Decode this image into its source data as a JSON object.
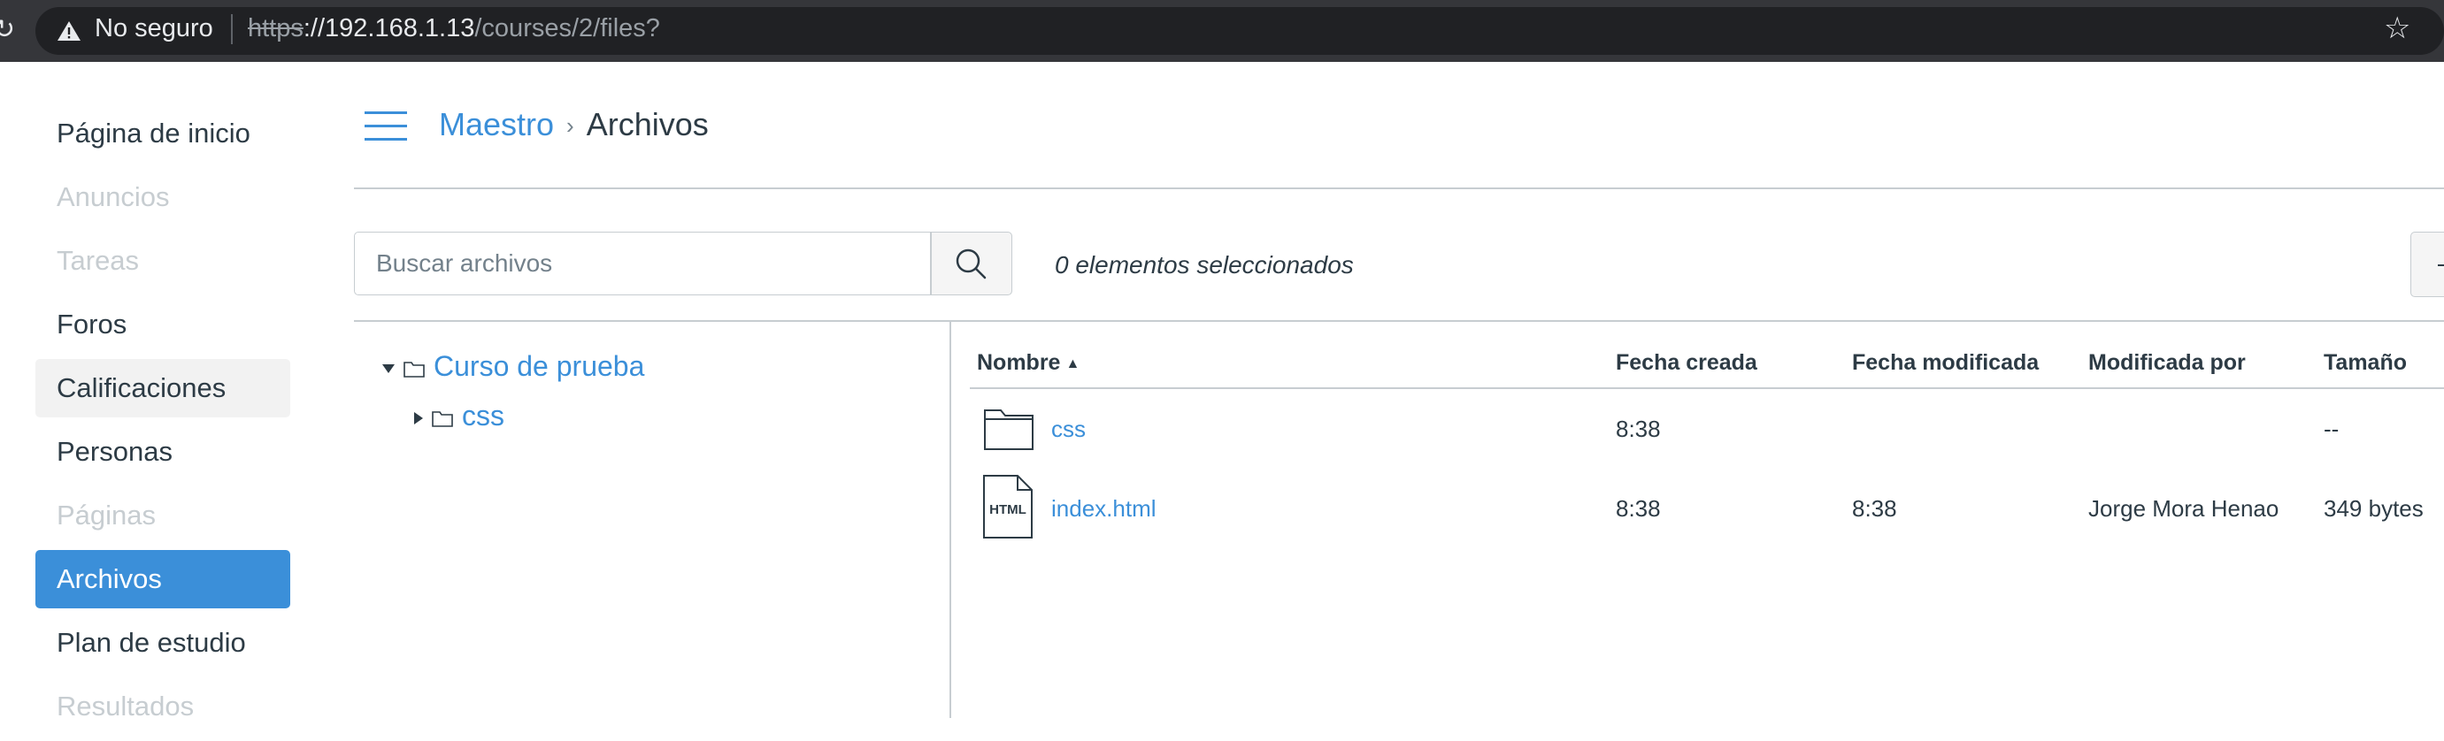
{
  "browser": {
    "security_label": "No seguro",
    "url_scheme": "https",
    "url_host": "://192.168.1.13",
    "url_path": "/courses/2/files?"
  },
  "course_nav": {
    "items": [
      {
        "label": "Página de inicio",
        "state": "normal"
      },
      {
        "label": "Anuncios",
        "state": "muted"
      },
      {
        "label": "Tareas",
        "state": "muted"
      },
      {
        "label": "Foros",
        "state": "normal"
      },
      {
        "label": "Calificaciones",
        "state": "hover"
      },
      {
        "label": "Personas",
        "state": "normal"
      },
      {
        "label": "Páginas",
        "state": "muted"
      },
      {
        "label": "Archivos",
        "state": "active"
      },
      {
        "label": "Plan de estudio",
        "state": "normal"
      },
      {
        "label": "Resultados",
        "state": "muted"
      }
    ]
  },
  "breadcrumb": {
    "course": "Maestro",
    "separator": "›",
    "current": "Archivos"
  },
  "toolbar": {
    "search_placeholder": "Buscar archivos",
    "selected_count": "0 elementos seleccionados"
  },
  "folder_tree": {
    "root": "Curso de prueba",
    "children": [
      "css"
    ]
  },
  "file_table": {
    "columns": [
      "Nombre",
      "Fecha creada",
      "Fecha modificada",
      "Modificada por",
      "Tamaño"
    ],
    "sort_indicator": "▲",
    "rows": [
      {
        "type": "folder",
        "name": "css",
        "created": "8:38",
        "modified": "",
        "modified_by": "",
        "size": "--"
      },
      {
        "type": "html",
        "icon_label": "HTML",
        "name": "index.html",
        "created": "8:38",
        "modified": "8:38",
        "modified_by": "Jorge Mora Henao",
        "size": "349 bytes"
      }
    ]
  },
  "colors": {
    "accent": "#3b8fd9",
    "text": "#2d3b45",
    "muted": "#c7cdd1",
    "chrome": "#35363a"
  }
}
